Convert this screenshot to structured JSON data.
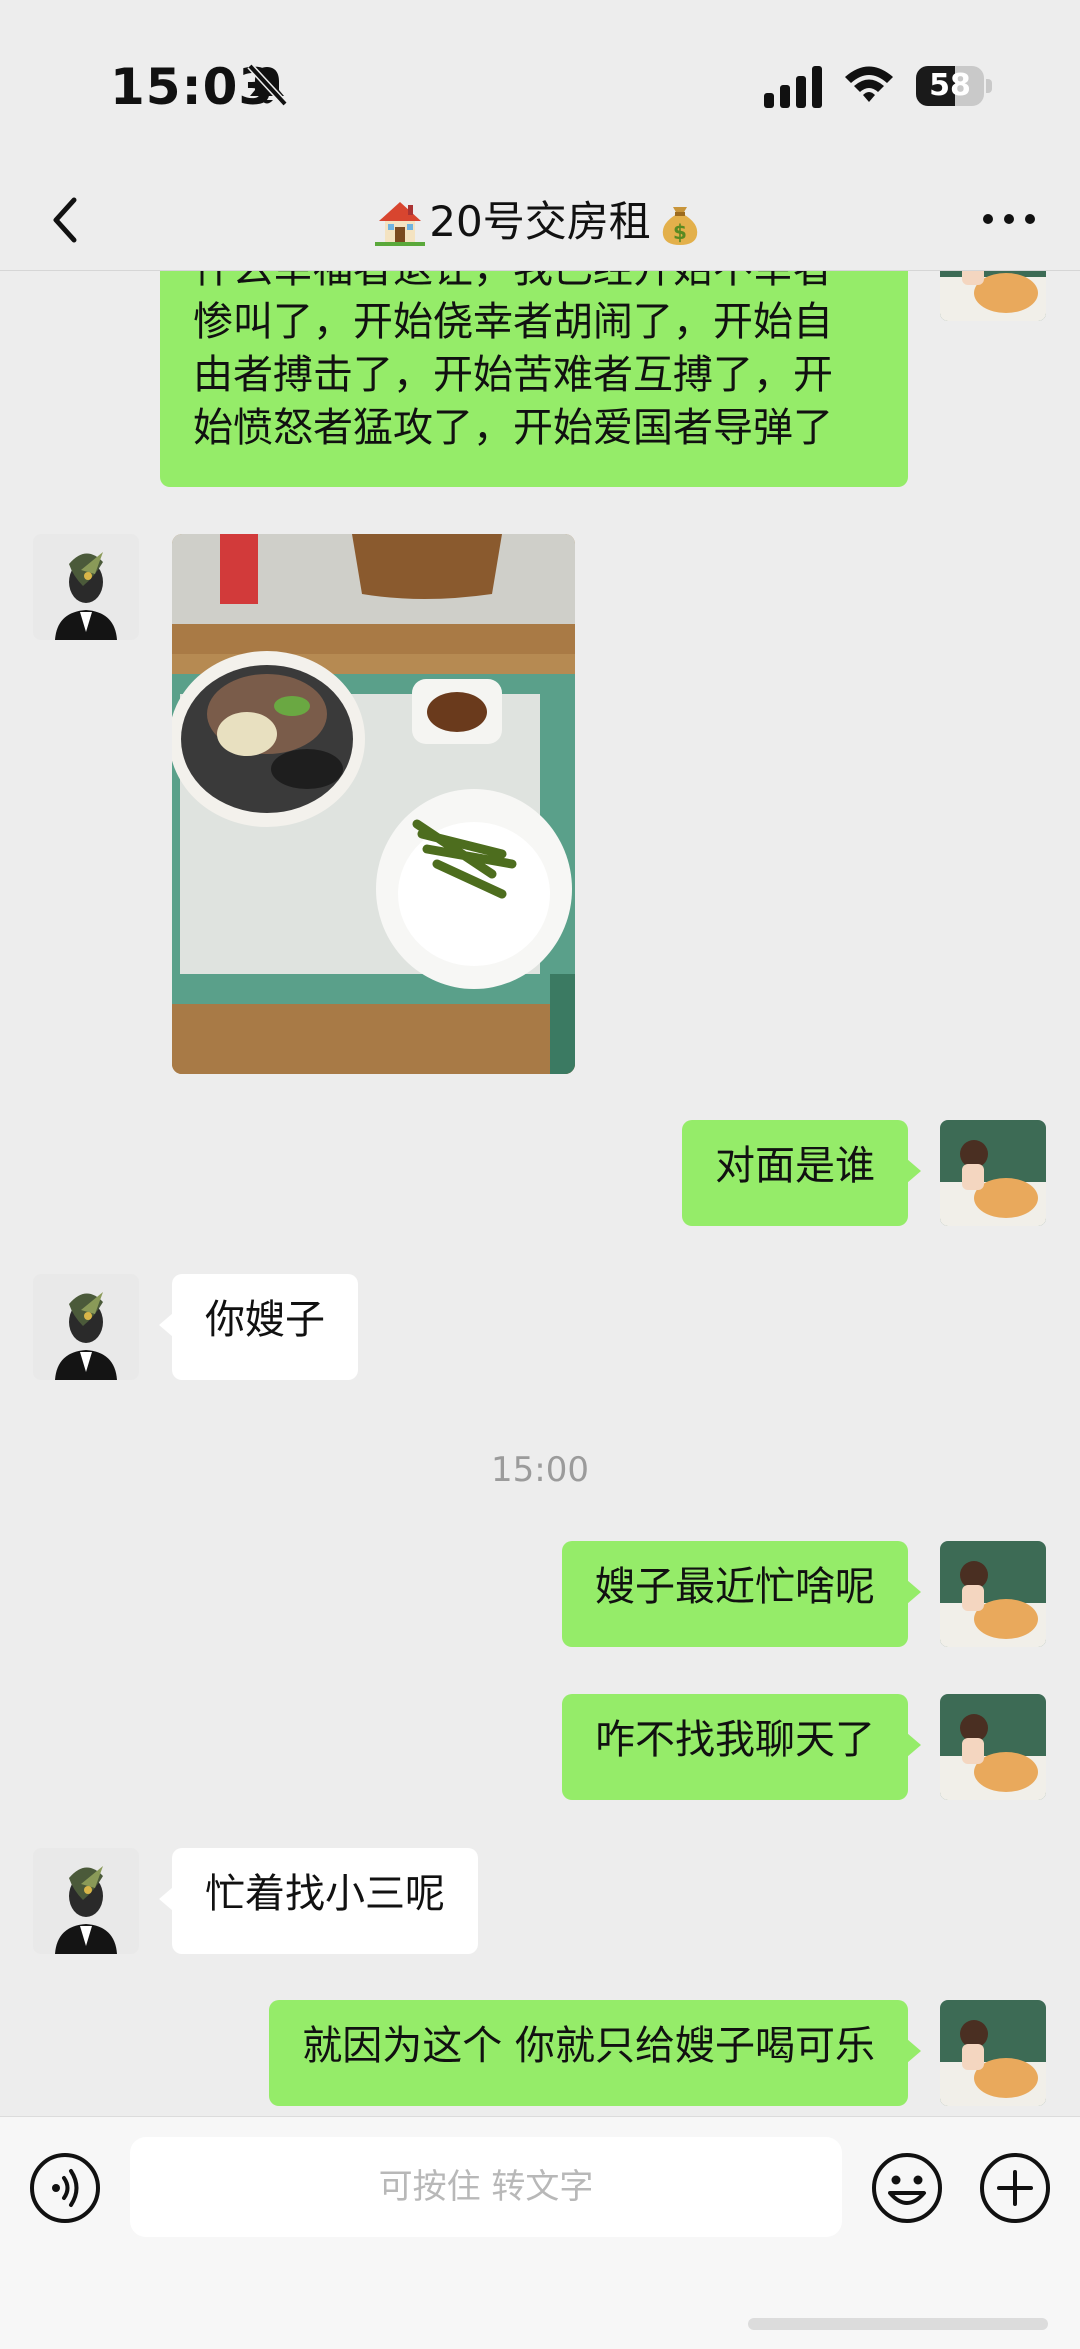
{
  "status_bar": {
    "time": "15:03",
    "battery": "58",
    "battery_level": 0.58
  },
  "nav": {
    "title": "20号交房租",
    "title_icon_left": "house-emoji",
    "title_icon_right": "money-bag-emoji"
  },
  "messages": [
    {
      "from": "me",
      "type": "text",
      "lines": [
        "什么幸福者退让，我已经开始不幸者",
        "惨叫了，开始侥幸者胡闹了，开始自",
        "由者搏击了，开始苦难者互搏了，开",
        "始愤怒者猛攻了，开始爱国者导弹了"
      ]
    },
    {
      "from": "other",
      "type": "image",
      "icon": "food-photo"
    },
    {
      "from": "me",
      "type": "text",
      "text": "对面是谁"
    },
    {
      "from": "other",
      "type": "text",
      "text": "你嫂子"
    },
    {
      "type": "time",
      "text": "15:00"
    },
    {
      "from": "me",
      "type": "text",
      "text": "嫂子最近忙啥呢"
    },
    {
      "from": "me",
      "type": "text",
      "text": "咋不找我聊天了"
    },
    {
      "from": "other",
      "type": "text",
      "text": "忙着找小三呢"
    },
    {
      "from": "me",
      "type": "text",
      "text": "就因为这个 你就只给嫂子喝可乐"
    }
  ],
  "input": {
    "placeholder": "可按住 转文字"
  },
  "colors": {
    "bubble_me": "#95ec69",
    "bubble_other": "#ffffff",
    "background": "#ededed"
  },
  "icons": [
    "bell-muted-icon",
    "signal-icon",
    "wifi-icon",
    "battery-icon",
    "back-icon",
    "more-icon",
    "voice-icon",
    "emoji-icon",
    "add-icon"
  ]
}
